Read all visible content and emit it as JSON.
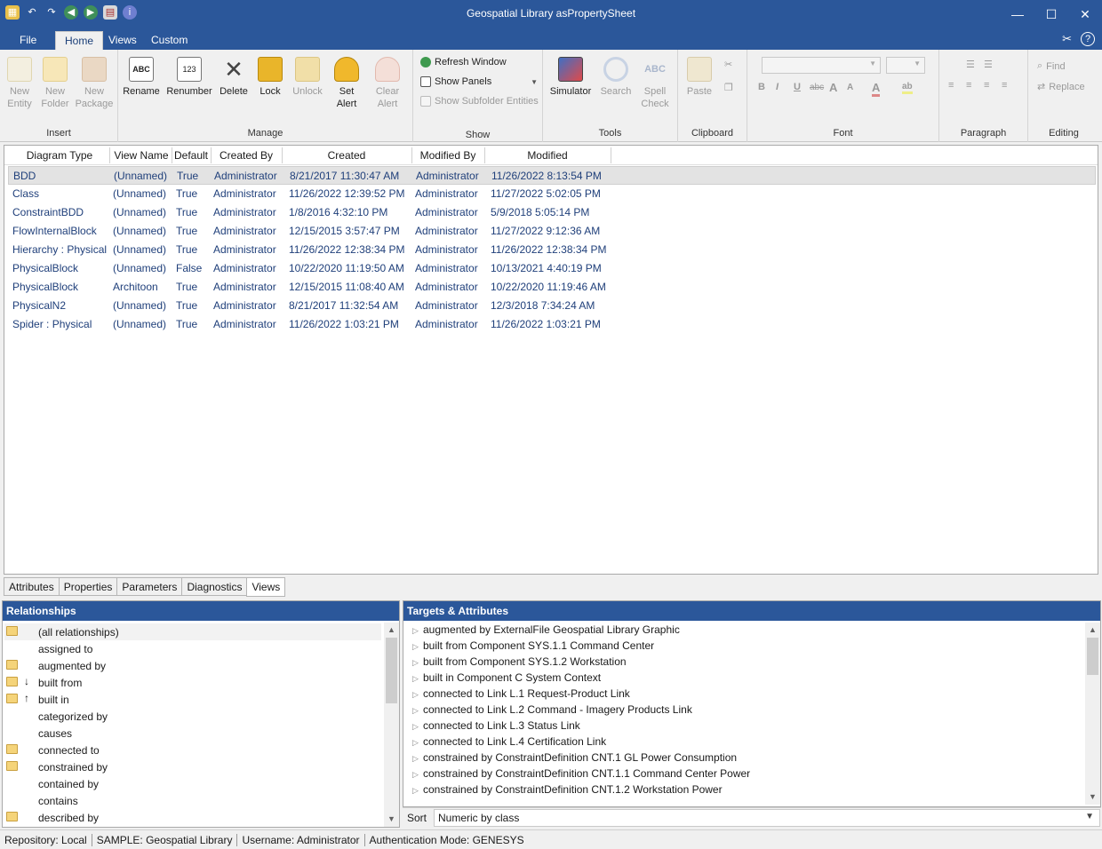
{
  "window": {
    "title": "Geospatial Library asPropertySheet"
  },
  "ribbon_tabs": [
    "File",
    "Home",
    "Views",
    "Custom"
  ],
  "ribbon": {
    "insert": {
      "label": "Insert",
      "buttons": [
        "New\nEntity",
        "New\nFolder",
        "New\nPackage"
      ]
    },
    "manage": {
      "label": "Manage",
      "buttons": [
        "Rename",
        "Renumber",
        "Delete",
        "Lock",
        "Unlock",
        "Set\nAlert",
        "Clear\nAlert"
      ]
    },
    "show": {
      "label": "Show",
      "refresh": "Refresh Window",
      "panels": "Show Panels",
      "subfolder": "Show Subfolder Entities"
    },
    "tools": {
      "label": "Tools",
      "buttons": [
        "Simulator",
        "Search",
        "Spell\nCheck"
      ]
    },
    "clipboard": {
      "label": "Clipboard",
      "paste": "Paste"
    },
    "font": {
      "label": "Font",
      "glyphs": [
        "B",
        "I",
        "U",
        "abc",
        "A",
        "A",
        "A",
        "ab"
      ]
    },
    "paragraph": {
      "label": "Paragraph"
    },
    "editing": {
      "label": "Editing",
      "find": "Find",
      "replace": "Replace"
    }
  },
  "grid": {
    "columns": [
      "Diagram Type",
      "View Name",
      "Default",
      "Created By",
      "Created",
      "Modified By",
      "Modified"
    ],
    "rows": [
      [
        "BDD",
        "(Unnamed)",
        "True",
        "Administrator",
        "8/21/2017 11:30:47 AM",
        "Administrator",
        "11/26/2022 8:13:54 PM"
      ],
      [
        "Class",
        "(Unnamed)",
        "True",
        "Administrator",
        "11/26/2022 12:39:52 PM",
        "Administrator",
        "11/27/2022 5:02:05 PM"
      ],
      [
        "ConstraintBDD",
        "(Unnamed)",
        "True",
        "Administrator",
        "1/8/2016 4:32:10 PM",
        "Administrator",
        "5/9/2018 5:05:14 PM"
      ],
      [
        "FlowInternalBlock",
        "(Unnamed)",
        "True",
        "Administrator",
        "12/15/2015 3:57:47 PM",
        "Administrator",
        "11/27/2022 9:12:36 AM"
      ],
      [
        "Hierarchy : Physical",
        "(Unnamed)",
        "True",
        "Administrator",
        "11/26/2022 12:38:34 PM",
        "Administrator",
        "11/26/2022 12:38:34 PM"
      ],
      [
        "PhysicalBlock",
        "(Unnamed)",
        "False",
        "Administrator",
        "10/22/2020 11:19:50 AM",
        "Administrator",
        "10/13/2021 4:40:19 PM"
      ],
      [
        "PhysicalBlock",
        "Architoon",
        "True",
        "Administrator",
        "12/15/2015 11:08:40 AM",
        "Administrator",
        "10/22/2020 11:19:46 AM"
      ],
      [
        "PhysicalN2",
        "(Unnamed)",
        "True",
        "Administrator",
        "8/21/2017 11:32:54 AM",
        "Administrator",
        "12/3/2018 7:34:24 AM"
      ],
      [
        "Spider : Physical",
        "(Unnamed)",
        "True",
        "Administrator",
        "11/26/2022 1:03:21 PM",
        "Administrator",
        "11/26/2022 1:03:21 PM"
      ]
    ]
  },
  "bottom_tabs": [
    "Attributes",
    "Properties",
    "Parameters",
    "Diagnostics",
    "Views"
  ],
  "relationships": {
    "title": "Relationships",
    "items": [
      {
        "label": "(all relationships)",
        "folder": true,
        "arrow": ""
      },
      {
        "label": "assigned to",
        "folder": false,
        "arrow": ""
      },
      {
        "label": "augmented by",
        "folder": true,
        "arrow": ""
      },
      {
        "label": "built from",
        "folder": true,
        "arrow": "↓"
      },
      {
        "label": "built in",
        "folder": true,
        "arrow": "↑"
      },
      {
        "label": "categorized by",
        "folder": false,
        "arrow": ""
      },
      {
        "label": "causes",
        "folder": false,
        "arrow": ""
      },
      {
        "label": "connected to",
        "folder": true,
        "arrow": ""
      },
      {
        "label": "constrained by",
        "folder": true,
        "arrow": ""
      },
      {
        "label": "contained by",
        "folder": false,
        "arrow": ""
      },
      {
        "label": "contains",
        "folder": false,
        "arrow": ""
      },
      {
        "label": "described by",
        "folder": true,
        "arrow": ""
      }
    ]
  },
  "targets": {
    "title": "Targets & Attributes",
    "items": [
      "augmented by ExternalFile  Geospatial Library Graphic",
      "built from Component SYS.1.1 Command Center",
      "built from Component SYS.1.2 Workstation",
      "built in Component C System Context",
      "connected to Link L.1 Request-Product Link",
      "connected to Link L.2 Command - Imagery Products Link",
      "connected to Link L.3 Status Link",
      "connected to Link L.4 Certification Link",
      "constrained by ConstraintDefinition CNT.1 GL Power Consumption",
      "constrained by ConstraintDefinition CNT.1.1 Command Center Power",
      "constrained by ConstraintDefinition CNT.1.2 Workstation Power"
    ],
    "sort_label": "Sort",
    "sort_value": "Numeric by class"
  },
  "status": [
    "Repository: Local",
    "SAMPLE: Geospatial Library",
    "Username: Administrator",
    "Authentication Mode: GENESYS"
  ]
}
